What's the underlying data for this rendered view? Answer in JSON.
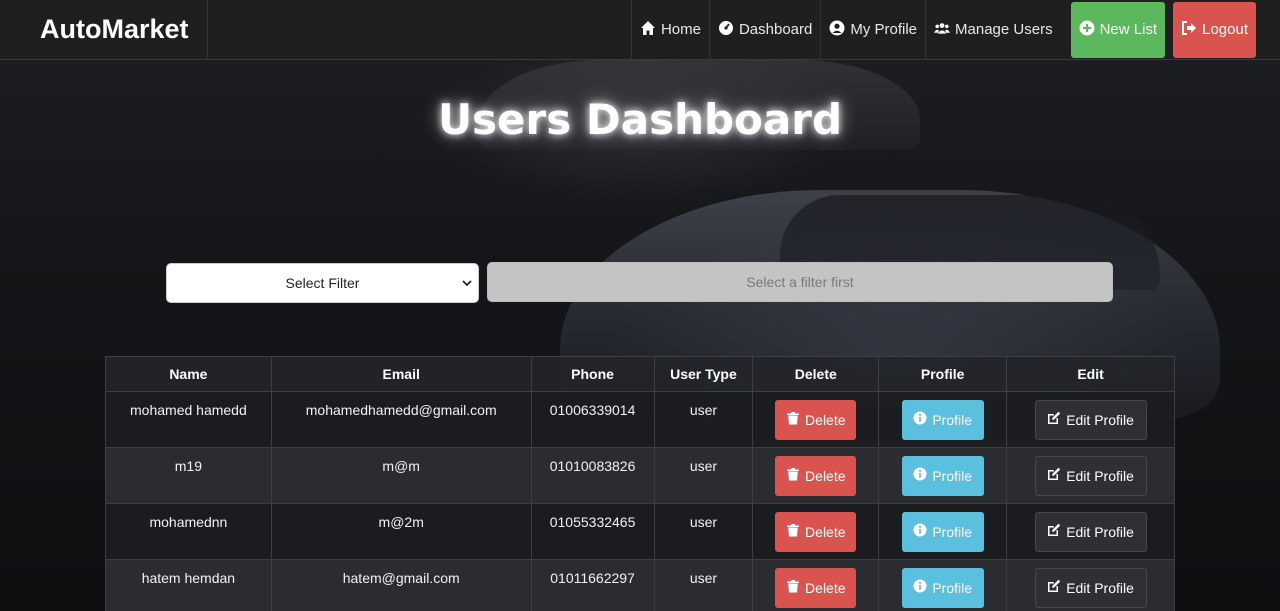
{
  "app": {
    "brand": "AutoMarket"
  },
  "nav": {
    "items": [
      {
        "label": "Home",
        "icon": "home-icon"
      },
      {
        "label": "Dashboard",
        "icon": "dashboard-icon"
      },
      {
        "label": "My Profile",
        "icon": "user-circle-icon"
      },
      {
        "label": "Manage Users",
        "icon": "users-icon"
      }
    ],
    "new_list": {
      "label": "New List",
      "icon": "plus-circle-icon",
      "color": "#5cb85c"
    },
    "logout": {
      "label": "Logout",
      "icon": "logout-icon",
      "color": "#d9534f"
    }
  },
  "page": {
    "title": "Users Dashboard"
  },
  "filter": {
    "select_value": "Select Filter",
    "input_placeholder": "Select a filter first"
  },
  "table": {
    "headers": [
      "Name",
      "Email",
      "Phone",
      "User Type",
      "Delete",
      "Profile",
      "Edit"
    ],
    "buttons": {
      "delete_label": "Delete",
      "profile_label": "Profile",
      "edit_label": "Edit Profile"
    },
    "rows": [
      {
        "name": "mohamed hamedd",
        "email": "mohamedhamedd@gmail.com",
        "phone": "01006339014",
        "type": "user"
      },
      {
        "name": "m19",
        "email": "m@m",
        "phone": "01010083826",
        "type": "user"
      },
      {
        "name": "mohamednn",
        "email": "m@2m",
        "phone": "01055332465",
        "type": "user"
      },
      {
        "name": "hatem hemdan",
        "email": "hatem@gmail.com",
        "phone": "01011662297",
        "type": "user"
      }
    ]
  },
  "colors": {
    "delete": "#d9534f",
    "profile": "#5bc0de",
    "new_list": "#5cb85c"
  }
}
